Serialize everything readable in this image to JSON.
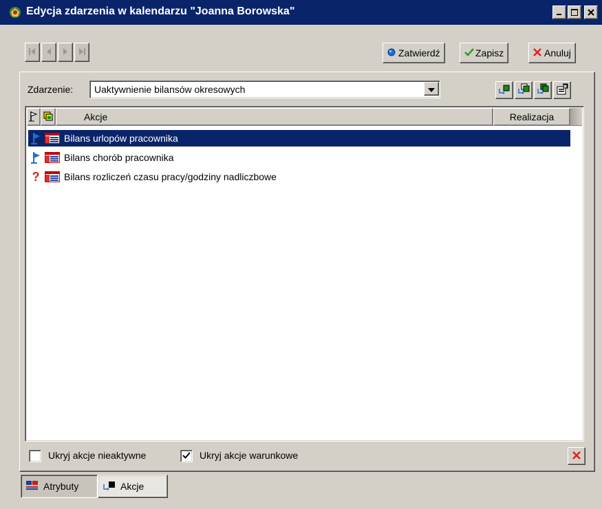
{
  "window": {
    "title": "Edycja zdarzenia w kalendarzu \"Joanna Borowska\"",
    "min_glyph": "_",
    "max_glyph": "□",
    "close_glyph": "✕"
  },
  "toolbar": {
    "confirm_label": "Zatwierdź",
    "save_label": "Zapisz",
    "cancel_label": "Anuluj"
  },
  "event": {
    "label": "Zdarzenie:",
    "value": "Uaktywnienie bilansów okresowych"
  },
  "grid": {
    "columns": [
      "Akcje",
      "Realizacja"
    ],
    "rows": [
      {
        "label": "Bilans urlopów pracownika",
        "status_icon": "flag-icon",
        "selected": true
      },
      {
        "label": "Bilans chorób pracownika",
        "status_icon": "flag-icon",
        "selected": false
      },
      {
        "label": "Bilans rozliczeń czasu pracy/godziny nadliczbowe",
        "status_icon": "question-icon",
        "selected": false
      }
    ]
  },
  "options": {
    "hide_inactive_label": "Ukryj akcje nieaktywne",
    "hide_inactive_checked": false,
    "hide_conditional_label": "Ukryj akcje warunkowe",
    "hide_conditional_checked": true
  },
  "tabs": [
    {
      "label": "Atrybuty",
      "icon": "attributes-icon",
      "active": false
    },
    {
      "label": "Akcje",
      "icon": "actions-icon",
      "active": true
    }
  ],
  "colors": {
    "titlebar": "#0a246a",
    "selection": "#0a246a",
    "face": "#d4d0c8",
    "cancel_red": "#e02020",
    "confirm_blue": "#1e6fd9",
    "save_green": "#2a9a2a"
  }
}
